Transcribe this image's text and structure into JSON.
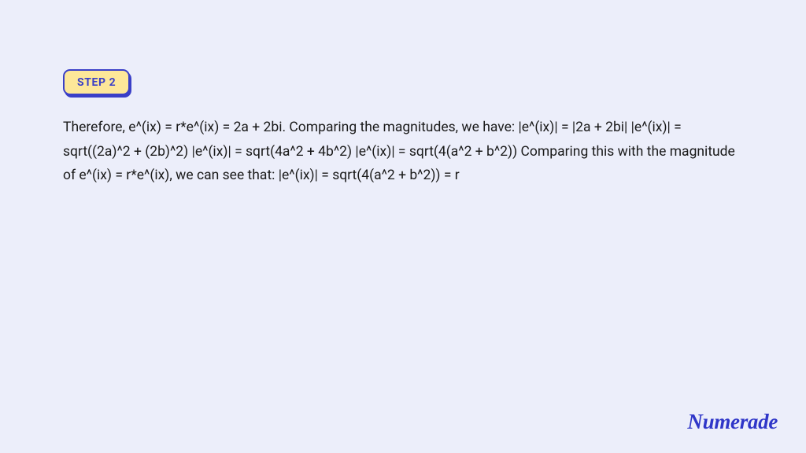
{
  "step": {
    "badge_label": "STEP 2",
    "body": "Therefore, e^(ix) = r*e^(ix) = 2a + 2bi. Comparing the magnitudes, we have: |e^(ix)| = |2a + 2bi| |e^(ix)| = sqrt((2a)^2 + (2b)^2) |e^(ix)| = sqrt(4a^2 + 4b^2) |e^(ix)| = sqrt(4(a^2 + b^2)) Comparing this with the magnitude of e^(ix) = r*e^(ix), we can see that: |e^(ix)| = sqrt(4(a^2 + b^2)) = r"
  },
  "brand": {
    "name": "Numerade"
  },
  "colors": {
    "background": "#eceefa",
    "accent": "#3a3fc7",
    "badge_bg": "#fde799",
    "text": "#1a1a1a"
  }
}
